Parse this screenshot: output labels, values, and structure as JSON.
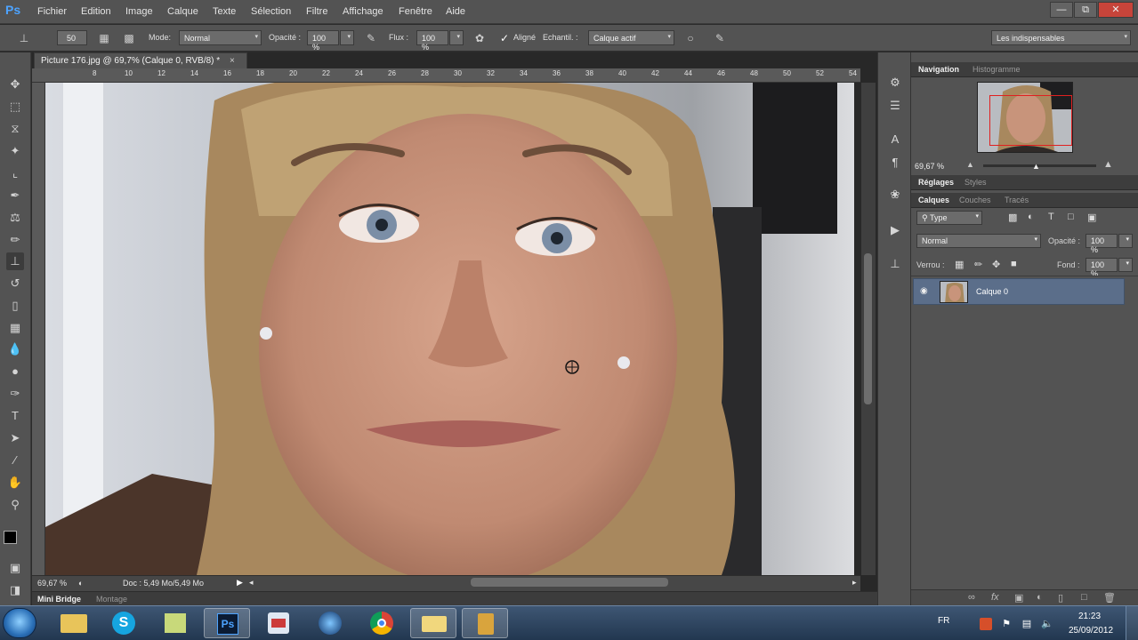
{
  "app": {
    "logo": "Ps",
    "menu": [
      "Fichier",
      "Edition",
      "Image",
      "Calque",
      "Texte",
      "Sélection",
      "Filtre",
      "Affichage",
      "Fenêtre",
      "Aide"
    ]
  },
  "options_bar": {
    "brush_size": "50",
    "mode_label": "Mode:",
    "mode_value": "Normal",
    "opacity_label": "Opacité :",
    "opacity_value": "100 %",
    "flow_label": "Flux :",
    "flow_value": "100 %",
    "aligned_label": "Aligné",
    "aligned_checked": true,
    "sample_label": "Echantil. :",
    "sample_value": "Calque actif",
    "workspace": "Les indispensables"
  },
  "document": {
    "tab_title": "Picture 176.jpg @ 69,7% (Calque 0, RVB/8) *",
    "ruler_ticks": [
      "8",
      "10",
      "12",
      "14",
      "16",
      "18",
      "20",
      "22",
      "24",
      "26",
      "28",
      "30",
      "32",
      "34",
      "36",
      "38",
      "40",
      "42",
      "44",
      "46",
      "48",
      "50",
      "52",
      "54",
      "56"
    ],
    "zoom": "69,67 %",
    "doc_info": "Doc : 5,49 Mo/5,49 Mo"
  },
  "bottom_tabs": [
    "Mini Bridge",
    "Montage"
  ],
  "navigation": {
    "tabs": [
      "Navigation",
      "Histogramme"
    ],
    "zoom": "69,67 %"
  },
  "adjustments": {
    "tabs": [
      "Réglages",
      "Styles"
    ]
  },
  "layers": {
    "tabs": [
      "Calques",
      "Couches",
      "Tracés"
    ],
    "filter_label": "Type",
    "blend_mode": "Normal",
    "opacity_label": "Opacité :",
    "opacity_value": "100 %",
    "lock_label": "Verrou :",
    "fill_label": "Fond :",
    "fill_value": "100 %",
    "items": [
      {
        "name": "Calque 0",
        "visible": true
      }
    ]
  },
  "taskbar": {
    "language": "FR",
    "time": "21:23",
    "date": "25/09/2012"
  },
  "icons": {
    "tools": [
      "move-icon",
      "marquee-icon",
      "lasso-icon",
      "quick-select-icon",
      "crop-icon",
      "eyedropper-icon",
      "healing-brush-icon",
      "brush-icon",
      "clone-stamp-icon",
      "history-brush-icon",
      "eraser-icon",
      "gradient-icon",
      "blur-icon",
      "dodge-icon",
      "pen-icon",
      "type-icon",
      "path-select-icon",
      "line-icon",
      "hand-icon",
      "zoom-icon"
    ]
  }
}
